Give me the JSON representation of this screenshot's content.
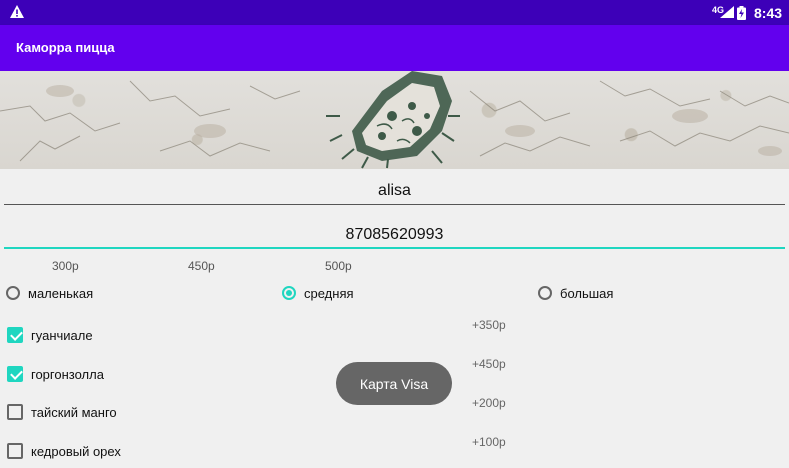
{
  "status_bar": {
    "network": "4G",
    "time": "8:43"
  },
  "app_bar": {
    "title": "Каморра пицца"
  },
  "form": {
    "name_value": "alisa",
    "phone_value": "87085620993"
  },
  "prices": [
    "300р",
    "450р",
    "500р"
  ],
  "sizes": [
    {
      "label": "маленькая",
      "selected": false
    },
    {
      "label": "средняя",
      "selected": true
    },
    {
      "label": "большая",
      "selected": false
    }
  ],
  "toppings": [
    {
      "label": "гуанчиале",
      "checked": true,
      "price": "+350р"
    },
    {
      "label": "горгонзолла",
      "checked": true,
      "price": "+450р"
    },
    {
      "label": "тайский манго",
      "checked": false,
      "price": "+200р"
    },
    {
      "label": "кедровый орех",
      "checked": false,
      "price": "+100р"
    }
  ],
  "pay_button": {
    "label": "Карта Visa"
  },
  "colors": {
    "status_bar": "#3d00b8",
    "app_bar": "#6200ee",
    "accent": "#1fd6c0",
    "button": "#666666"
  }
}
